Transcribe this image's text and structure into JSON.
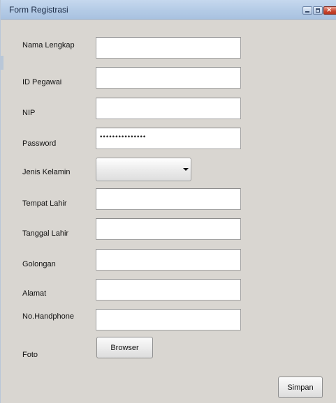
{
  "window": {
    "title": "Form Registrasi"
  },
  "form": {
    "fields": [
      {
        "label": "Nama Lengkap",
        "value": ""
      },
      {
        "label": "ID Pegawai",
        "value": ""
      },
      {
        "label": "NIP",
        "value": ""
      },
      {
        "label": "Password",
        "value": "•••••••••••••••"
      },
      {
        "label": "Jenis Kelamin",
        "value": ""
      },
      {
        "label": "Tempat Lahir",
        "value": ""
      },
      {
        "label": "Tanggal Lahir",
        "value": ""
      },
      {
        "label": "Golongan",
        "value": ""
      },
      {
        "label": "Alamat",
        "value": ""
      },
      {
        "label": "No.Handphone",
        "value": ""
      },
      {
        "label": "Foto"
      }
    ],
    "browse_label": "Browser",
    "save_label": "Simpan"
  },
  "icons": {
    "minimize": "minimize-icon",
    "maximize": "maximize-icon",
    "close": "close-icon",
    "dropdown": "chevron-down-icon"
  },
  "colors": {
    "window_bg": "#d9d6d1",
    "titlebar": "#b4cbe6",
    "close_button": "#c9462f"
  }
}
